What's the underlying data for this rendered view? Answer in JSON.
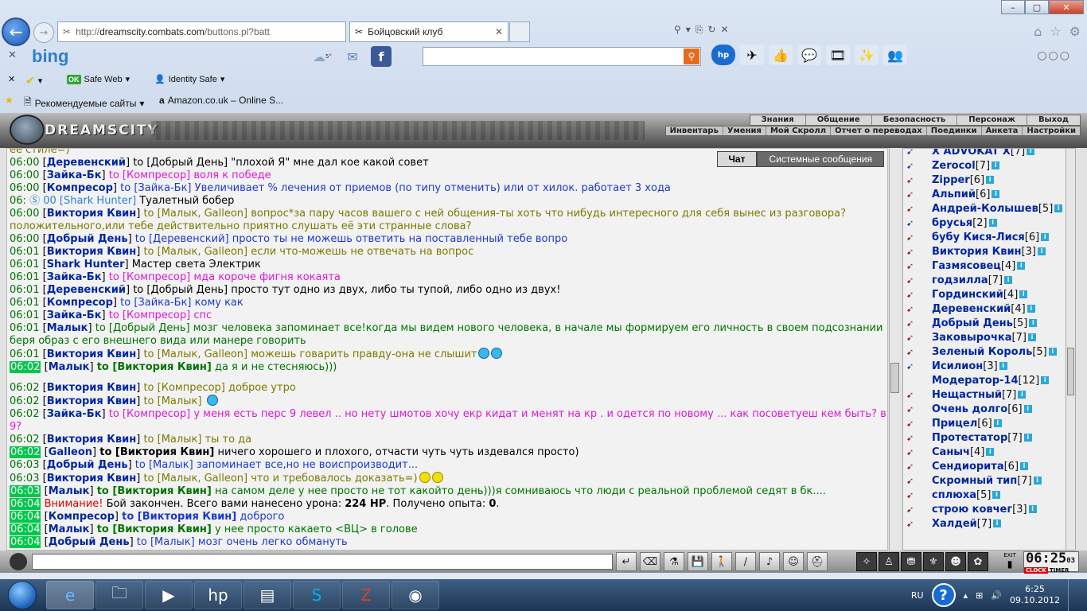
{
  "browser": {
    "address_prefix": "http://",
    "address_domain": "dreamscity.combats.com",
    "address_rest": "/buttons.pl?batt",
    "tab_title": "Бойцовский клуб",
    "bing_logo": "bing",
    "weather_badge": "5°",
    "toolbar_icons": [
      "weather-icon",
      "mail-icon",
      "facebook-icon"
    ],
    "hp_label": "hp",
    "safe_web": "Safe Web",
    "identity_safe": "Identity Safe",
    "favorites": [
      "Рекомендуемые сайты",
      "Amazon.co.uk – Online S..."
    ]
  },
  "game": {
    "logo_text": "DREAMSCITY",
    "top_menu": [
      "Знания",
      "Общение",
      "Безопасность",
      "Персонаж",
      "Выход"
    ],
    "sub_menu": [
      "Инвентарь",
      "Умения",
      "Мой Скролл",
      "Отчет о переводах",
      "Поединки",
      "Анкета",
      "Настройки"
    ],
    "chat_tabs": [
      "Чат",
      "Системные сообщения"
    ],
    "messages": [
      {
        "time": "",
        "name": "",
        "target": "",
        "text": "её стиле=)",
        "cls": "c-olive"
      },
      {
        "time": "06:00",
        "name": "Деревенский",
        "target": "to [Добрый День]",
        "text": "\"плохой Я\" мне дал кое какой совет",
        "cls": "c-dark"
      },
      {
        "time": "06:00",
        "name": "Зайка-Бк",
        "target": "to [Компресор]",
        "text": "воля к победе",
        "cls": "c-pink"
      },
      {
        "time": "06:00",
        "name": "Компресор",
        "target": "to [Зайка-Бк]",
        "text": "Увеличивает % лечения от приемов (по типу отменить) или от хилок. работает 3 хода",
        "cls": "c-blue"
      },
      {
        "time": "06:",
        "name": "",
        "target": "00 [Shark Hunter]",
        "text": "Туалетный бобер",
        "cls": "c-dark",
        "sky": true
      },
      {
        "time": "06:00",
        "name": "Виктория Квин",
        "target": "to [Малык, Galleon]",
        "text": "вопрос*за пару часов вашего с ней общения-ты хоть что нибудь интересного для себя вынес из разговора? положительного,или тебе действительно приятно слушать её эти странные слова?",
        "cls": "c-olive"
      },
      {
        "time": "06:00",
        "name": "Добрый День",
        "target": "to [Деревенский]",
        "text": "просто ты не можешь ответить на поставленный тебе вопро",
        "cls": "c-blue"
      },
      {
        "time": "06:01",
        "name": "Виктория Квин",
        "target": "to [Малык, Galleon]",
        "text": "если что-можешь не отвечать на вопрос",
        "cls": "c-olive"
      },
      {
        "time": "06:01",
        "name": "Shark Hunter",
        "target": "",
        "text": "Мастер света Электрик",
        "cls": "c-dark"
      },
      {
        "time": "06:01",
        "name": "Зайка-Бк",
        "target": "to [Компресор]",
        "text": "мда короче фигня кокаята",
        "cls": "c-pink"
      },
      {
        "time": "06:01",
        "name": "Деревенский",
        "target": "to [Добрый День]",
        "text": "просто тут одно из двух, либо ты тупой, либо одно из двух!",
        "cls": "c-dark"
      },
      {
        "time": "06:01",
        "name": "Компресор",
        "target": "to [Зайка-Бк]",
        "text": "кому как",
        "cls": "c-blue"
      },
      {
        "time": "06:01",
        "name": "Зайка-Бк",
        "target": "to [Компресор]",
        "text": "спс",
        "cls": "c-pink"
      },
      {
        "time": "06:01",
        "name": "Малык",
        "target": "to [Добрый День]",
        "text": "мозг человека запоминает все!когда мы видем нового человека, в начале мы формируем его личность в своем подсознании беря образ с его внешнего вида или манере говорить",
        "cls": "c-green"
      },
      {
        "time": "06:01",
        "name": "Виктория Квин",
        "target": "to [Малык, Galleon]",
        "text": "можешь говарить правду-она не слышит",
        "cls": "c-olive",
        "smiles": 2
      },
      {
        "time": "06:02",
        "name": "Малык",
        "target": "to [Виктория Квин]",
        "text": "да я и не стесняюсь)))",
        "cls": "c-green",
        "hl": true,
        "boldtarget": true
      },
      {
        "gap": true
      },
      {
        "time": "06:02",
        "name": "Виктория Квин",
        "target": "to [Компресор]",
        "text": "доброе утро",
        "cls": "c-olive"
      },
      {
        "time": "06:02",
        "name": "Виктория Квин",
        "target": "to [Малык]",
        "text": "",
        "cls": "c-olive",
        "smiles": 1
      },
      {
        "time": "06:02",
        "name": "Зайка-Бк",
        "target": "to [Компресор]",
        "text": "у меня есть перс 9 левел .. но нету шмотов хочу екр кидат и менят на кр . и одется по новому ... как посоветуеш кем быть? в 9?",
        "cls": "c-pink"
      },
      {
        "time": "06:02",
        "name": "Виктория Квин",
        "target": "to [Малык]",
        "text": "ты то да",
        "cls": "c-olive"
      },
      {
        "time": "06:02",
        "name": "Galleon",
        "target": "to [Виктория Квин]",
        "text": "ничего хорошего и плохого, отчасти чуть чуть издевался просто)",
        "cls": "c-dark",
        "hl": true,
        "boldtarget": true
      },
      {
        "time": "06:03",
        "name": "Добрый День",
        "target": "to [Малык]",
        "text": "запоминает все,но не воиспроизводит...",
        "cls": "c-blue"
      },
      {
        "time": "06:03",
        "name": "Виктория Квин",
        "target": "to [Малык, Galleon]",
        "text": "что и требовалось доказать=)",
        "cls": "c-olive",
        "ysmiles": 2
      },
      {
        "time": "06:03",
        "name": "Малык",
        "target": "to [Виктория Квин]",
        "text": "на самом деле у нее просто не тот какойто день)))я сомниваюсь что люди с реальной проблемой седят в бк....",
        "cls": "c-green",
        "hl": true,
        "boldtarget": true
      },
      {
        "time": "06:04",
        "system": true,
        "alert": "Внимание!",
        "text": "Бой закончен. Всего вами нанесено урона:",
        "hp": "224 HP",
        "text2": ". Получено опыта:",
        "exp": "0",
        "hl": true
      },
      {
        "time": "06:04",
        "name": "Компресор",
        "target": "to [Виктория Квин]",
        "text": "доброго",
        "cls": "c-blue",
        "hl": true,
        "boldtarget": true
      },
      {
        "time": "06:04",
        "name": "Малык",
        "target": "to [Виктория Квин]",
        "text": "у нее просто какаето <ВЦ> в голове",
        "cls": "c-green",
        "hl": true,
        "boldtarget": true
      },
      {
        "time": "06:04",
        "name": "Добрый День",
        "target": "to [Малык]",
        "text": "мозг очень легко обмануть",
        "cls": "c-blue",
        "hl": true
      }
    ],
    "users": [
      {
        "name": "X ADVOKAT X",
        "lvl": "[7]",
        "ico": "blue"
      },
      {
        "name": "Zerocol",
        "lvl": "[7]",
        "ico": "blue"
      },
      {
        "name": "Zipper",
        "lvl": "[6]",
        "ico": "red"
      },
      {
        "name": "Альпий",
        "lvl": "[6]",
        "ico": "red"
      },
      {
        "name": "Андрей-Колышев",
        "lvl": "[5]",
        "ico": "red"
      },
      {
        "name": "брусья",
        "lvl": "[2]",
        "ico": "blue"
      },
      {
        "name": "бубу Кися-Лися",
        "lvl": "[6]",
        "ico": "red"
      },
      {
        "name": "Виктория Квин",
        "lvl": "[3]",
        "ico": "red"
      },
      {
        "name": "Газмясовец",
        "lvl": "[4]",
        "ico": "red"
      },
      {
        "name": "годзилла",
        "lvl": "[7]",
        "ico": "red"
      },
      {
        "name": "Гординский",
        "lvl": "[4]",
        "ico": "red"
      },
      {
        "name": "Деревенский",
        "lvl": "[4]",
        "ico": "red"
      },
      {
        "name": "Добрый День",
        "lvl": "[5]",
        "ico": "red"
      },
      {
        "name": "Заковырочка",
        "lvl": "[7]",
        "ico": "red"
      },
      {
        "name": "Зеленый Король",
        "lvl": "[5]",
        "ico": "red"
      },
      {
        "name": "Исилион",
        "lvl": "[3]",
        "ico": "blue"
      },
      {
        "name": "Модератор-14",
        "lvl": "[12]",
        "ico": "",
        "indent": true
      },
      {
        "name": "Нещастный",
        "lvl": "[7]",
        "ico": "red"
      },
      {
        "name": "Очень долго",
        "lvl": "[6]",
        "ico": "red"
      },
      {
        "name": "Прицел",
        "lvl": "[6]",
        "ico": "red"
      },
      {
        "name": "Протестатор",
        "lvl": "[7]",
        "ico": "red"
      },
      {
        "name": "Саныч",
        "lvl": "[4]",
        "ico": "red"
      },
      {
        "name": "Сендиорита",
        "lvl": "[6]",
        "ico": "red"
      },
      {
        "name": "Скромный тип",
        "lvl": "[7]",
        "ico": "red"
      },
      {
        "name": "сплюха",
        "lvl": "[5]",
        "ico": "red"
      },
      {
        "name": "строю ковчег",
        "lvl": "[3]",
        "ico": "red"
      },
      {
        "name": "Халдей",
        "lvl": "[7]",
        "ico": "red"
      }
    ],
    "exit_label": "EXIT",
    "clock": {
      "time": "06:25",
      "sec": "03",
      "label1": "CLOCK",
      "label2": "TIMER"
    }
  },
  "taskbar": {
    "lang": "RU",
    "time": "6:25",
    "date": "09.10.2012"
  }
}
